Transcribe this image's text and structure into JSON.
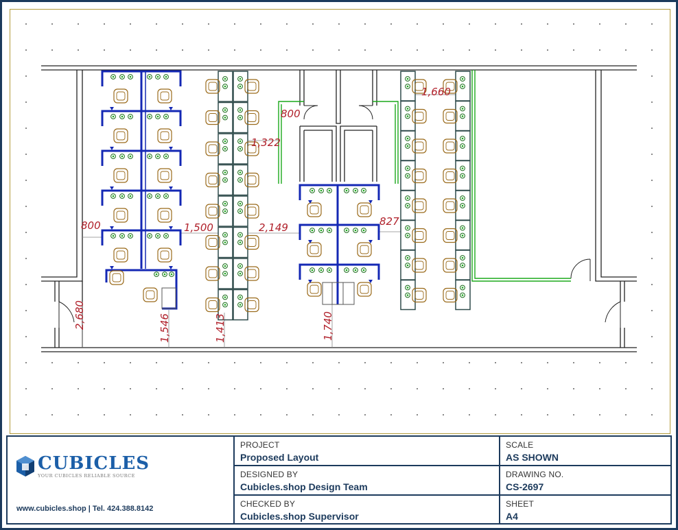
{
  "drawing": {
    "dimensions": [
      "800",
      "1,500",
      "2,149",
      "827",
      "800",
      "1,322",
      "1,660",
      "2,680",
      "1,546",
      "1,413",
      "1,740"
    ],
    "colors": {
      "wall": "#222222",
      "panel": "#1428b4",
      "workstation": "#2e4a4a",
      "chair": "#9a6a1a",
      "accent": "#1aa81a",
      "dimension": "#b0202a"
    }
  },
  "title_block": {
    "brand": "CUBICLES",
    "tagline": "YOUR CUBICLES RELIABLE SOURCE",
    "contact": "www.cubicles.shop  |  Tel. 424.388.8142",
    "project_label": "PROJECT",
    "project_value": "Proposed Layout",
    "designed_label": "DESIGNED BY",
    "designed_value": "Cubicles.shop Design Team",
    "checked_label": "CHECKED BY",
    "checked_value": "Cubicles.shop Supervisor",
    "scale_label": "SCALE",
    "scale_value": "AS SHOWN",
    "drawing_no_label": "DRAWING NO.",
    "drawing_no_value": "CS-2697",
    "sheet_label": "SHEET",
    "sheet_value": "A4"
  }
}
